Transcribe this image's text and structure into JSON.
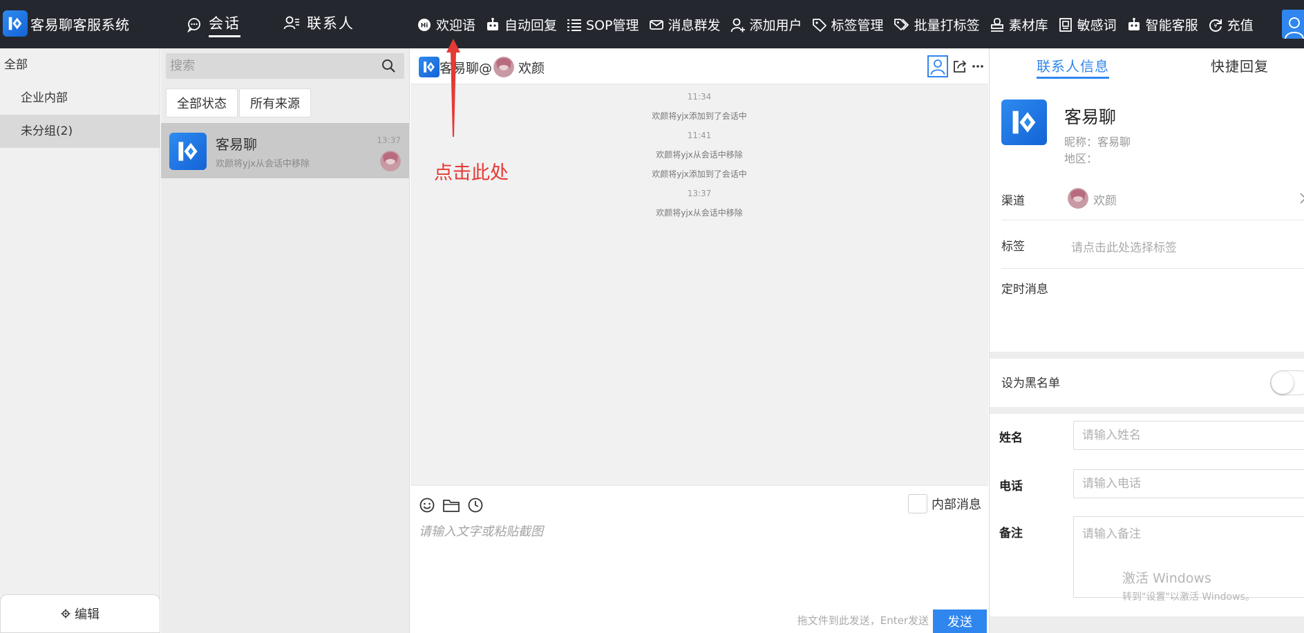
{
  "app": {
    "title": "客易聊客服系统"
  },
  "main_tabs": [
    {
      "label": "会话",
      "active": true
    },
    {
      "label": "联系人",
      "active": false
    }
  ],
  "toolbar": [
    {
      "label": "欢迎语",
      "icon": "hi-bubble-icon"
    },
    {
      "label": "自动回复",
      "icon": "robot-icon"
    },
    {
      "label": "SOP管理",
      "icon": "list-icon"
    },
    {
      "label": "消息群发",
      "icon": "mail-icon"
    },
    {
      "label": "添加用户",
      "icon": "add-user-icon"
    },
    {
      "label": "标签管理",
      "icon": "tag-icon"
    },
    {
      "label": "批量打标签",
      "icon": "tags-icon"
    },
    {
      "label": "素材库",
      "icon": "stamp-icon"
    },
    {
      "label": "敏感词",
      "icon": "book-icon"
    },
    {
      "label": "智能客服",
      "icon": "robot-icon"
    },
    {
      "label": "充值",
      "icon": "refresh-icon"
    }
  ],
  "groups": {
    "all_label": "全部",
    "items": [
      {
        "label": "企业内部",
        "active": false
      },
      {
        "label": "未分组(2)",
        "active": true
      }
    ],
    "edit_label": "编辑"
  },
  "conversations": {
    "search_placeholder": "搜索",
    "filters": [
      "全部状态",
      "所有来源"
    ],
    "items": [
      {
        "name": "客易聊",
        "preview": "欢颜将yjx从会话中移除",
        "time": "13:37"
      }
    ]
  },
  "chat": {
    "title_prefix": "客易聊@",
    "title_contact": "欢颜",
    "messages": [
      {
        "type": "time",
        "text": "11:34"
      },
      {
        "type": "system",
        "text": "欢颜将yjx添加到了会话中"
      },
      {
        "type": "time",
        "text": "11:41"
      },
      {
        "type": "system",
        "text": "欢颜将yjx从会话中移除"
      },
      {
        "type": "system",
        "text": "欢颜将yjx添加到了会话中"
      },
      {
        "type": "time",
        "text": "13:37"
      },
      {
        "type": "system",
        "text": "欢颜将yjx从会话中移除"
      }
    ],
    "internal_label": "内部消息",
    "input_placeholder": "请输入文字或粘贴截图",
    "send_hint": "拖文件到此发送，Enter发送",
    "send_label": "发送",
    "annotation": "点击此处"
  },
  "info": {
    "tabs": [
      {
        "label": "联系人信息",
        "active": true
      },
      {
        "label": "快捷回复",
        "active": false
      }
    ],
    "name": "客易聊",
    "nickname": "昵称：客易聊",
    "region": "地区：",
    "channel_label": "渠道",
    "channel_value": "欢颜",
    "tag_label": "标签",
    "tag_placeholder": "请点击此处选择标签",
    "scheduled_label": "定时消息",
    "blacklist_label": "设为黑名单",
    "blacklist_on": false,
    "fields": [
      {
        "label": "姓名",
        "placeholder": "请输入姓名"
      },
      {
        "label": "电话",
        "placeholder": "请输入电话"
      },
      {
        "label": "备注",
        "placeholder": "请输入备注"
      }
    ]
  },
  "system_watermark": {
    "line1": "激活 Windows",
    "line2": "转到\"设置\"以激活 Windows。"
  },
  "colors": {
    "topbar": "#24272e",
    "accent": "#2f86ee",
    "annotation": "#e53935"
  }
}
